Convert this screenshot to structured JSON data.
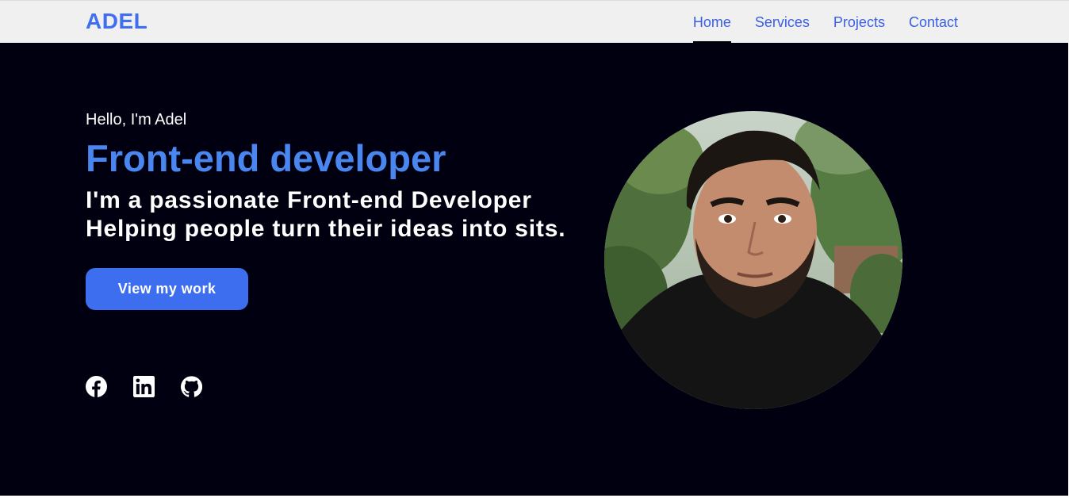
{
  "navbar": {
    "logo": "ADEL",
    "links": [
      {
        "label": "Home",
        "active": true
      },
      {
        "label": "Services",
        "active": false
      },
      {
        "label": "Projects",
        "active": false
      },
      {
        "label": "Contact",
        "active": false
      }
    ]
  },
  "hero": {
    "greeting": "Hello, I'm Adel",
    "role": "Front-end developer",
    "tagline": "I'm a passionate Front-end Developer Helping people turn their ideas into sits.",
    "cta_label": "View my work",
    "socials": [
      {
        "icon": "facebook-icon"
      },
      {
        "icon": "linkedin-icon"
      },
      {
        "icon": "github-icon"
      }
    ],
    "avatar": {
      "icon": "profile-photo"
    }
  },
  "colors": {
    "accent": "#3d6ef0",
    "heading_blue": "#4a86f0",
    "hero_bg": "#000011",
    "navbar_bg": "#f0f0f0"
  }
}
